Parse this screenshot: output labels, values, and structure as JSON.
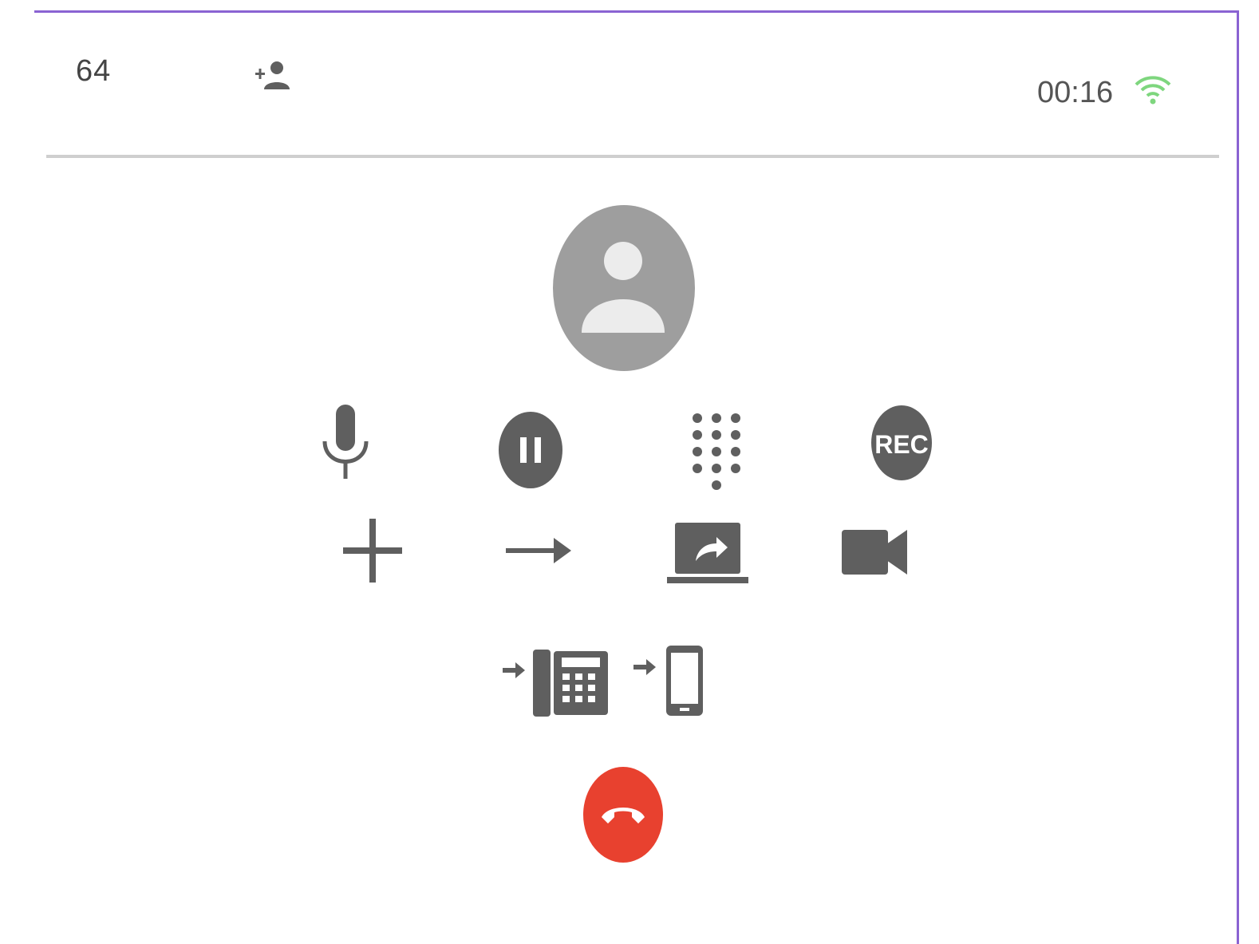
{
  "header": {
    "call_id": "64",
    "timer": "00:16",
    "add_contact_icon": "person-add-icon",
    "signal_icon": "wifi-signal-icon"
  },
  "avatar_icon": "person-avatar-icon",
  "controls": {
    "row1": [
      "mute-microphone",
      "hold",
      "dialpad",
      "record"
    ],
    "row2": [
      "add-call",
      "transfer",
      "share-screen",
      "video"
    ],
    "row3": [
      "transfer-to-desk-phone",
      "transfer-to-mobile"
    ],
    "record_label": "REC"
  },
  "hangup_icon": "phone-hangup-icon",
  "colors": {
    "accent_border": "#8a63d2",
    "icon": "#5f5f5f",
    "signal": "#7ed67e",
    "hangup": "#e8412f",
    "avatar": "#9e9e9e"
  }
}
